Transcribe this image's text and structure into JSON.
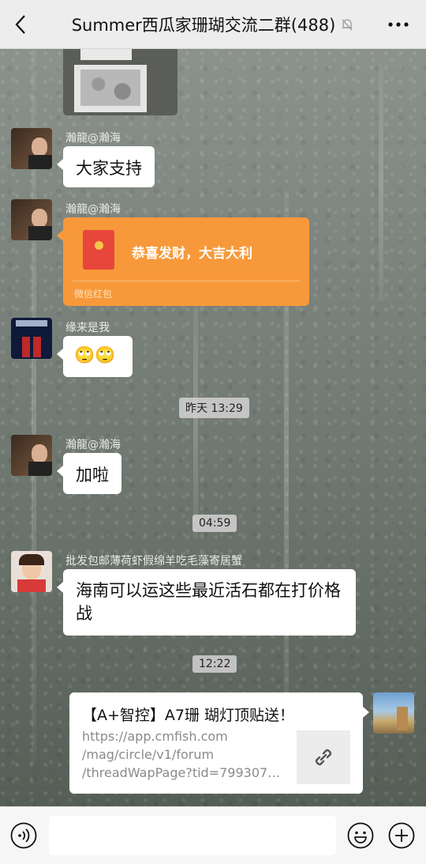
{
  "header": {
    "title": "Summer西瓜家珊瑚交流二群(488)",
    "back_icon": "chevron-left-icon",
    "mute_icon": "bell-off-icon",
    "more_icon": "more-dots-icon"
  },
  "messages": [
    {
      "sender": "瀚龍@瀚海",
      "text": "大家支持"
    },
    {
      "sender": "瀚龍@瀚海",
      "type": "red-packet",
      "title": "恭喜发财，大吉大利",
      "label": "微信红包"
    },
    {
      "sender": "缘来是我",
      "text": "🙄🙄"
    },
    {
      "timestamp": "昨天 13:29"
    },
    {
      "sender": "瀚龍@瀚海",
      "text": "加啦"
    },
    {
      "timestamp": "04:59"
    },
    {
      "sender": "批发包邮薄荷虾假绵羊吃毛藻寄居蟹",
      "text_line1": "海南可以运这些最近活石都在打价格",
      "text_line2": "战"
    },
    {
      "timestamp": "12:22"
    },
    {
      "type": "link-card",
      "title": "【A+智控】A7珊 瑚灯顶贴送！",
      "url_line1": "https://app.cmfish.com",
      "url_line2": "/mag/circle/v1/forum",
      "url_line3": "/threadWapPage?tid=799307…",
      "thumb_icon": "link-icon"
    }
  ],
  "footer": {
    "voice_icon": "voice-icon",
    "input_value": "",
    "emoji_icon": "emoji-icon",
    "plus_icon": "plus-icon"
  },
  "colors": {
    "header_bg": "#ededed",
    "red_packet": "#f7993a",
    "bubble": "#ffffff",
    "footer_bg": "#f6f6f6"
  }
}
